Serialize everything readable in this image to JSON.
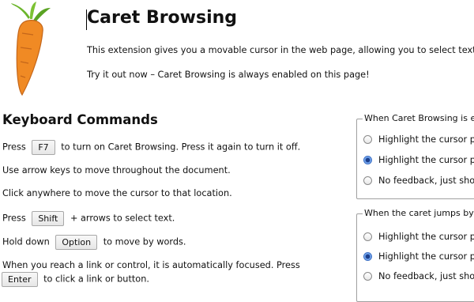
{
  "page": {
    "title": "Caret Browsing",
    "intro_1": "This extension gives you a movable cursor in the web page, allowing you to select text",
    "intro_2": "Try it out now – Caret Browsing is always enabled on this page!"
  },
  "commands": {
    "heading": "Keyboard Commands",
    "line1": {
      "pre": "Press",
      "key": "F7",
      "post": "to turn on Caret Browsing. Press it again to turn it off."
    },
    "line2": "Use arrow keys to move throughout the document.",
    "line3": "Click anywhere to move the cursor to that location.",
    "line4": {
      "pre": "Press",
      "key": "Shift",
      "post": "+ arrows to select text."
    },
    "line5": {
      "pre": "Hold down",
      "key": "Option",
      "post": "to move by words."
    },
    "line6": "When you reach a link or control, it is automatically focused. Press",
    "line7": {
      "key": "Enter",
      "post": "to click a link or button."
    }
  },
  "settings": {
    "group1": {
      "legend": "When Caret Browsing is e",
      "options": [
        "Highlight the cursor p",
        "Highlight the cursor p",
        "No feedback, just sho"
      ],
      "selected_index": 1
    },
    "group2": {
      "legend": "When the caret jumps by",
      "options": [
        "Highlight the cursor p",
        "Highlight the cursor p",
        "No feedback, just sho"
      ],
      "selected_index": 1
    }
  },
  "colors": {
    "accent_radio": "#3b6fc4",
    "carrot_orange": "#f08a24",
    "leaf_green": "#6bb52b"
  }
}
